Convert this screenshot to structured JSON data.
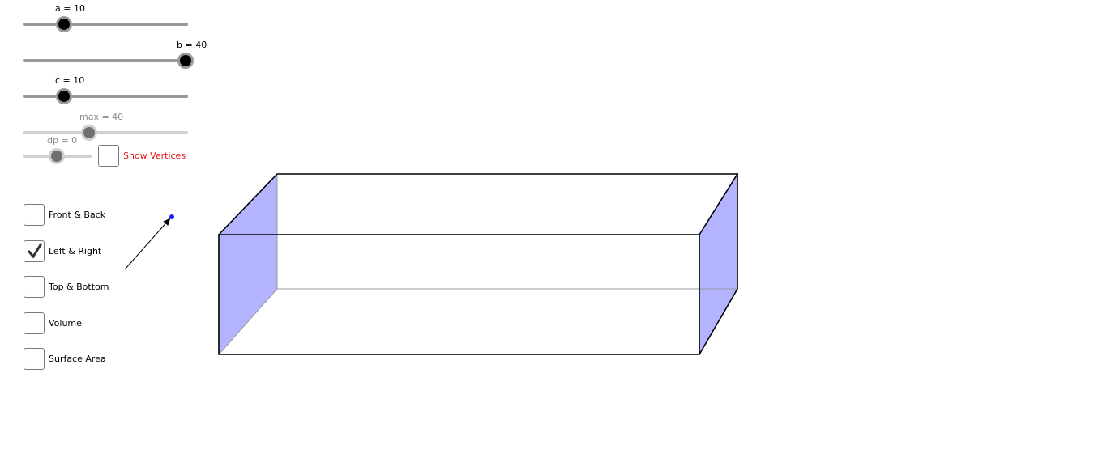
{
  "sliders": {
    "a": {
      "label": "a = 10",
      "value": 10
    },
    "b": {
      "label": "b = 40",
      "value": 40
    },
    "c": {
      "label": "c = 10",
      "value": 10
    },
    "max": {
      "label": "max = 40",
      "value": 40
    },
    "dp": {
      "label": "dp = 0",
      "value": 0
    }
  },
  "checkboxes": {
    "show_vertices": {
      "label": "Show Vertices",
      "checked": false,
      "color": "#e81010"
    },
    "front_back": {
      "label": "Front & Back",
      "checked": false
    },
    "left_right": {
      "label": "Left & Right",
      "checked": true
    },
    "top_bottom": {
      "label": "Top & Bottom",
      "checked": false
    },
    "volume": {
      "label": "Volume",
      "checked": false
    },
    "surface_area": {
      "label": "Surface Area",
      "checked": false
    }
  },
  "colors": {
    "face_fill": "#b3b3ff",
    "edge": "#000000",
    "hidden_edge": "#9a9a9a",
    "point": "#1a1aff"
  }
}
